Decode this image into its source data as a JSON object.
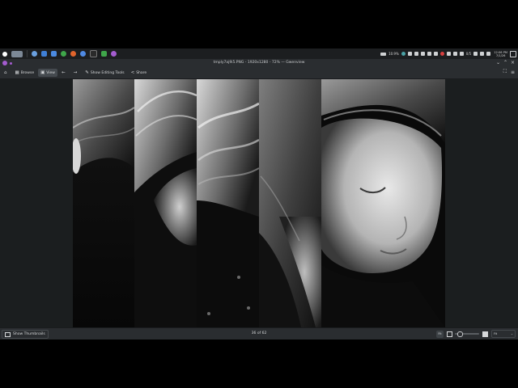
{
  "window": {
    "title": "tmply7aj9i5.PNG - 1920x1280 - 72% — Gwenview"
  },
  "toolbar": {
    "browse_label": "Browse",
    "view_label": "View",
    "editing_label": "Show Editing Tools",
    "share_label": "Share"
  },
  "tray": {
    "battery": "10.9%",
    "level": "0/5",
    "time": "12:06 PM",
    "date": "7/1/26"
  },
  "statusbar": {
    "thumbnails_label": "Show Thumbnails",
    "counter": "36 of 62",
    "fit_label": "Fit",
    "zoom_select": "Fit",
    "zoom_level": 0.1
  },
  "colors": {
    "window_bg": "#2a2d30",
    "viewer_bg": "#1b1e1f",
    "accent": "#a45ccf",
    "text": "#d6d8da"
  }
}
